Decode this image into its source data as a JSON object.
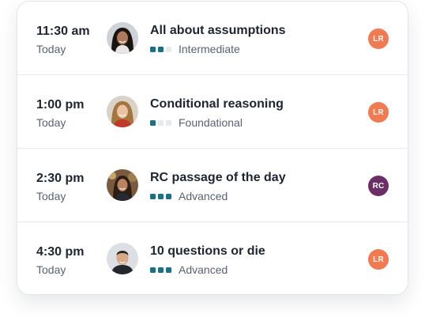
{
  "sessions": [
    {
      "time": "11:30 am",
      "day": "Today",
      "title": "All about assumptions",
      "level": "Intermediate",
      "level_value": 2,
      "level_max": 3,
      "badge": "LR",
      "badge_color": "#f07a52",
      "avatar_icon": "woman-dark-hair-avatar"
    },
    {
      "time": "1:00 pm",
      "day": "Today",
      "title": "Conditional reasoning",
      "level": "Foundational",
      "level_value": 1,
      "level_max": 3,
      "badge": "LR",
      "badge_color": "#f07a52",
      "avatar_icon": "woman-blonde-hair-avatar"
    },
    {
      "time": "2:30 pm",
      "day": "Today",
      "title": "RC passage of the day",
      "level": "Advanced",
      "level_value": 3,
      "level_max": 3,
      "badge": "RC",
      "badge_color": "#6b2f66",
      "avatar_icon": "woman-outdoor-avatar"
    },
    {
      "time": "4:30 pm",
      "day": "Today",
      "title": "10 questions or die",
      "level": "Advanced",
      "level_value": 3,
      "level_max": 3,
      "badge": "LR",
      "badge_color": "#f07a52",
      "avatar_icon": "man-short-hair-avatar"
    }
  ],
  "colors": {
    "dot_active": "#1e6f86",
    "dot_inactive": "#e6e9ee"
  }
}
